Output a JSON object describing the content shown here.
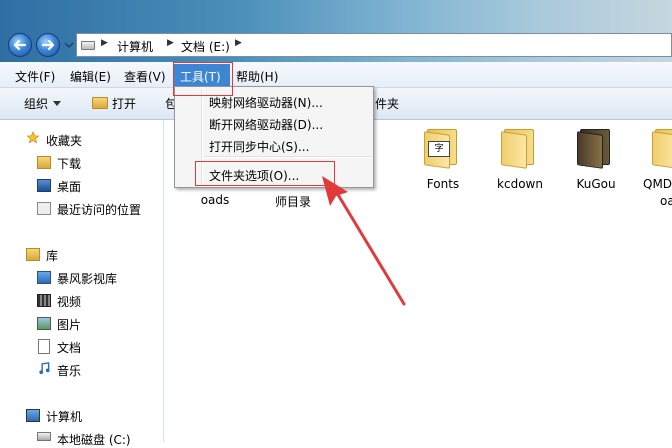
{
  "window": {
    "breadcrumbs": [
      "计算机",
      "文档 (E:)"
    ]
  },
  "menubar": {
    "items": [
      "文件(F)",
      "编辑(E)",
      "查看(V)",
      "工具(T)",
      "帮助(H)"
    ],
    "open_index": 3
  },
  "toolbar": {
    "organize": "组织",
    "open": "打开",
    "include_partial": "包",
    "folder_partial": "件夹"
  },
  "tools_menu": {
    "items": [
      "映射网络驱动器(N)...",
      "断开网络驱动器(D)...",
      "打开同步中心(S)...",
      "文件夹选项(O)..."
    ]
  },
  "navpane": {
    "favorites": {
      "title": "收藏夹",
      "items": [
        "下载",
        "桌面",
        "最近访问的位置"
      ]
    },
    "libraries": {
      "title": "库",
      "items": [
        "暴风影视库",
        "视频",
        "图片",
        "文档",
        "音乐"
      ]
    },
    "computer": {
      "title": "计算机",
      "items": [
        "本地磁盘 (C:)"
      ]
    }
  },
  "content": {
    "partial_labels": [
      "oads",
      "师目录"
    ],
    "folders": [
      "Fonts",
      "kcdown",
      "KuGou",
      "QMD"
    ],
    "qmd_second_line": "oa"
  },
  "colors": {
    "menu_highlight": "#3e86d4",
    "annotation_red": "#e23a3a"
  },
  "icons": {
    "back": "back-arrow-icon",
    "forward": "forward-arrow-icon",
    "favorites": "star-icon",
    "library": "library-icon",
    "computer": "computer-icon"
  }
}
